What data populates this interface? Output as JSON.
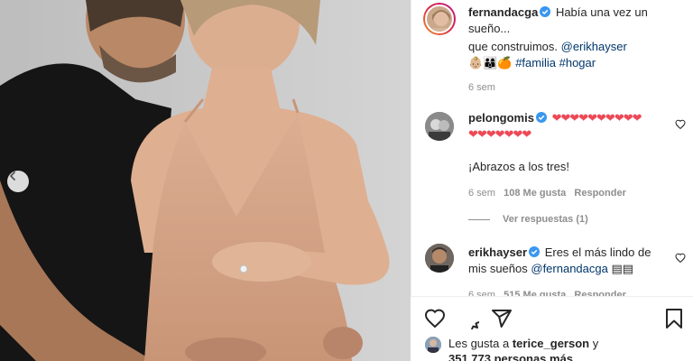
{
  "post": {
    "author": "fernandacga",
    "caption_line1": "Había una vez un",
    "caption_line2": "sueño...",
    "caption_line3_text": "que construimos.",
    "caption_mention": "@erikhayser",
    "caption_emoji": "👶🏼👨‍👩‍👦🍊",
    "caption_tag1": "#familia",
    "caption_tag2": "#hogar",
    "time": "6 sem"
  },
  "comments": [
    {
      "user": "pelongomis",
      "hearts": "❤️❤️❤️❤️❤️❤️❤️❤️❤️❤️❤️❤️❤️❤️❤️❤️❤️",
      "hearts_line1": "❤❤❤❤❤❤❤❤❤❤",
      "hearts_line2": "❤❤❤❤❤❤❤",
      "text": "¡Abrazos a los tres!",
      "time": "6 sem",
      "likes": "108 Me gusta",
      "reply_label": "Responder",
      "view_replies": "Ver respuestas (1)"
    },
    {
      "user": "erikhayser",
      "text_line1": "Eres el más lindo de",
      "text_line2_pre": "mis sueños",
      "mention": "@fernandacga",
      "emoji": "▤▤",
      "time": "6 sem",
      "likes": "515 Me gusta",
      "reply_label": "Responder"
    }
  ],
  "likes": {
    "prefix": "Les gusta a",
    "user": "terice_gerson",
    "conj": "y",
    "count": "351,773 personas más"
  },
  "icons": {
    "prev": "chevron-left-icon",
    "verified": "verified-badge-icon",
    "like": "heart-icon",
    "comment": "comment-icon",
    "share": "share-icon",
    "save": "bookmark-icon"
  },
  "colors": {
    "verified": "#3897f0",
    "link": "#00376b",
    "heart_red": "#ed4956",
    "meta": "#8e8e8e"
  }
}
